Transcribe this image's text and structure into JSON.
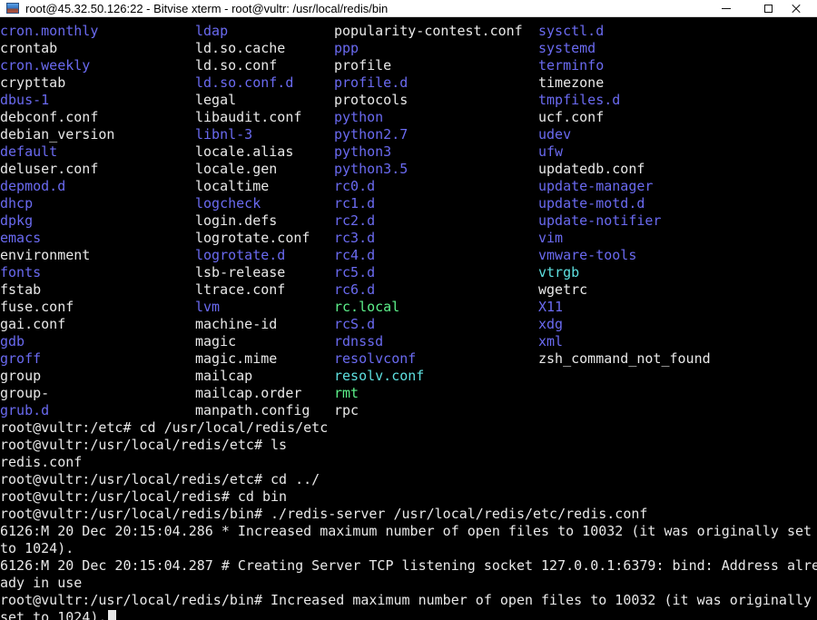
{
  "window": {
    "title": "root@45.32.50.126:22 - Bitvise xterm - root@vultr: /usr/local/redis/bin"
  },
  "colors": {
    "white": "#e8e8e8",
    "blue": "#6a6af0",
    "green": "#5cf08a",
    "cyan": "#5ee0e0"
  },
  "listing": [
    [
      {
        "t": "cron.monthly",
        "c": "blue"
      },
      {
        "t": "ldap",
        "c": "blue"
      },
      {
        "t": "popularity-contest.conf",
        "c": "white"
      },
      {
        "t": "sysctl.d",
        "c": "blue"
      }
    ],
    [
      {
        "t": "crontab",
        "c": "white"
      },
      {
        "t": "ld.so.cache",
        "c": "white"
      },
      {
        "t": "ppp",
        "c": "blue"
      },
      {
        "t": "systemd",
        "c": "blue"
      }
    ],
    [
      {
        "t": "cron.weekly",
        "c": "blue"
      },
      {
        "t": "ld.so.conf",
        "c": "white"
      },
      {
        "t": "profile",
        "c": "white"
      },
      {
        "t": "terminfo",
        "c": "blue"
      }
    ],
    [
      {
        "t": "crypttab",
        "c": "white"
      },
      {
        "t": "ld.so.conf.d",
        "c": "blue"
      },
      {
        "t": "profile.d",
        "c": "blue"
      },
      {
        "t": "timezone",
        "c": "white"
      }
    ],
    [
      {
        "t": "dbus-1",
        "c": "blue"
      },
      {
        "t": "legal",
        "c": "white"
      },
      {
        "t": "protocols",
        "c": "white"
      },
      {
        "t": "tmpfiles.d",
        "c": "blue"
      }
    ],
    [
      {
        "t": "debconf.conf",
        "c": "white"
      },
      {
        "t": "libaudit.conf",
        "c": "white"
      },
      {
        "t": "python",
        "c": "blue"
      },
      {
        "t": "ucf.conf",
        "c": "white"
      }
    ],
    [
      {
        "t": "debian_version",
        "c": "white"
      },
      {
        "t": "libnl-3",
        "c": "blue"
      },
      {
        "t": "python2.7",
        "c": "blue"
      },
      {
        "t": "udev",
        "c": "blue"
      }
    ],
    [
      {
        "t": "default",
        "c": "blue"
      },
      {
        "t": "locale.alias",
        "c": "white"
      },
      {
        "t": "python3",
        "c": "blue"
      },
      {
        "t": "ufw",
        "c": "blue"
      }
    ],
    [
      {
        "t": "deluser.conf",
        "c": "white"
      },
      {
        "t": "locale.gen",
        "c": "white"
      },
      {
        "t": "python3.5",
        "c": "blue"
      },
      {
        "t": "updatedb.conf",
        "c": "white"
      }
    ],
    [
      {
        "t": "depmod.d",
        "c": "blue"
      },
      {
        "t": "localtime",
        "c": "white"
      },
      {
        "t": "rc0.d",
        "c": "blue"
      },
      {
        "t": "update-manager",
        "c": "blue"
      }
    ],
    [
      {
        "t": "dhcp",
        "c": "blue"
      },
      {
        "t": "logcheck",
        "c": "blue"
      },
      {
        "t": "rc1.d",
        "c": "blue"
      },
      {
        "t": "update-motd.d",
        "c": "blue"
      }
    ],
    [
      {
        "t": "dpkg",
        "c": "blue"
      },
      {
        "t": "login.defs",
        "c": "white"
      },
      {
        "t": "rc2.d",
        "c": "blue"
      },
      {
        "t": "update-notifier",
        "c": "blue"
      }
    ],
    [
      {
        "t": "emacs",
        "c": "blue"
      },
      {
        "t": "logrotate.conf",
        "c": "white"
      },
      {
        "t": "rc3.d",
        "c": "blue"
      },
      {
        "t": "vim",
        "c": "blue"
      }
    ],
    [
      {
        "t": "environment",
        "c": "white"
      },
      {
        "t": "logrotate.d",
        "c": "blue"
      },
      {
        "t": "rc4.d",
        "c": "blue"
      },
      {
        "t": "vmware-tools",
        "c": "blue"
      }
    ],
    [
      {
        "t": "fonts",
        "c": "blue"
      },
      {
        "t": "lsb-release",
        "c": "white"
      },
      {
        "t": "rc5.d",
        "c": "blue"
      },
      {
        "t": "vtrgb",
        "c": "cyan"
      }
    ],
    [
      {
        "t": "fstab",
        "c": "white"
      },
      {
        "t": "ltrace.conf",
        "c": "white"
      },
      {
        "t": "rc6.d",
        "c": "blue"
      },
      {
        "t": "wgetrc",
        "c": "white"
      }
    ],
    [
      {
        "t": "fuse.conf",
        "c": "white"
      },
      {
        "t": "lvm",
        "c": "blue"
      },
      {
        "t": "rc.local",
        "c": "green"
      },
      {
        "t": "X11",
        "c": "blue"
      }
    ],
    [
      {
        "t": "gai.conf",
        "c": "white"
      },
      {
        "t": "machine-id",
        "c": "white"
      },
      {
        "t": "rcS.d",
        "c": "blue"
      },
      {
        "t": "xdg",
        "c": "blue"
      }
    ],
    [
      {
        "t": "gdb",
        "c": "blue"
      },
      {
        "t": "magic",
        "c": "white"
      },
      {
        "t": "rdnssd",
        "c": "blue"
      },
      {
        "t": "xml",
        "c": "blue"
      }
    ],
    [
      {
        "t": "groff",
        "c": "blue"
      },
      {
        "t": "magic.mime",
        "c": "white"
      },
      {
        "t": "resolvconf",
        "c": "blue"
      },
      {
        "t": "zsh_command_not_found",
        "c": "white"
      }
    ],
    [
      {
        "t": "group",
        "c": "white"
      },
      {
        "t": "mailcap",
        "c": "white"
      },
      {
        "t": "resolv.conf",
        "c": "cyan"
      },
      {
        "t": "",
        "c": "white"
      }
    ],
    [
      {
        "t": "group-",
        "c": "white"
      },
      {
        "t": "mailcap.order",
        "c": "white"
      },
      {
        "t": "rmt",
        "c": "green"
      },
      {
        "t": "",
        "c": "white"
      }
    ],
    [
      {
        "t": "grub.d",
        "c": "blue"
      },
      {
        "t": "manpath.config",
        "c": "white"
      },
      {
        "t": "rpc",
        "c": "white"
      },
      {
        "t": "",
        "c": "white"
      }
    ]
  ],
  "lines": [
    "root@vultr:/etc# cd /usr/local/redis/etc",
    "root@vultr:/usr/local/redis/etc# ls",
    "redis.conf",
    "root@vultr:/usr/local/redis/etc# cd ../",
    "root@vultr:/usr/local/redis# cd bin",
    "root@vultr:/usr/local/redis/bin# ./redis-server /usr/local/redis/etc/redis.conf",
    "6126:M 20 Dec 20:15:04.286 * Increased maximum number of open files to 10032 (it was originally set",
    "to 1024).",
    "6126:M 20 Dec 20:15:04.287 # Creating Server TCP listening socket 127.0.0.1:6379: bind: Address alre",
    "ady in use",
    "root@vultr:/usr/local/redis/bin# Increased maximum number of open files to 10032 (it was originally",
    "set to 1024)."
  ]
}
